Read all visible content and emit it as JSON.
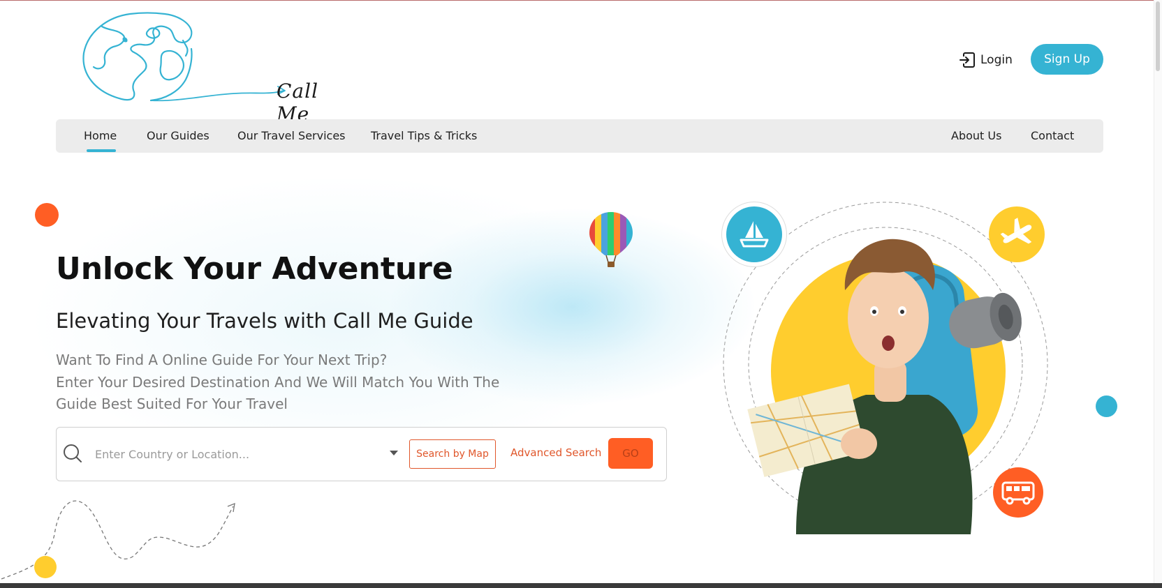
{
  "brand": {
    "logo_text": "Call Me Guide"
  },
  "header": {
    "login_label": "Login",
    "signup_label": "Sign Up"
  },
  "nav": {
    "items": [
      {
        "label": "Home",
        "active": true
      },
      {
        "label": "Our Guides"
      },
      {
        "label": "Our Travel Services"
      },
      {
        "label": "Travel Tips & Tricks"
      },
      {
        "label": "About Us"
      },
      {
        "label": "Contact"
      }
    ]
  },
  "hero": {
    "title": "Unlock Your Adventure",
    "subtitle": "Elevating Your Travels with Call Me Guide",
    "description_lines": [
      "Want To Find A Online Guide For Your Next Trip?",
      "Enter Your Desired Destination And We Will Match You With The",
      "Guide Best Suited For Your Travel"
    ]
  },
  "search": {
    "placeholder": "Enter Country or Location...",
    "value": "",
    "map_button": "Search by Map",
    "advanced_link": "Advanced Search",
    "go_button": "GO"
  },
  "icons": {
    "boat": "boat-icon",
    "plane": "airplane-icon",
    "bus": "bus-icon",
    "balloon": "hot-air-balloon-icon",
    "login": "login-icon",
    "search": "search-icon"
  },
  "colors": {
    "accent_blue": "#35b3d3",
    "accent_orange": "#ff5e24",
    "accent_yellow": "#ffcd2e",
    "nav_bg": "#ececec"
  }
}
